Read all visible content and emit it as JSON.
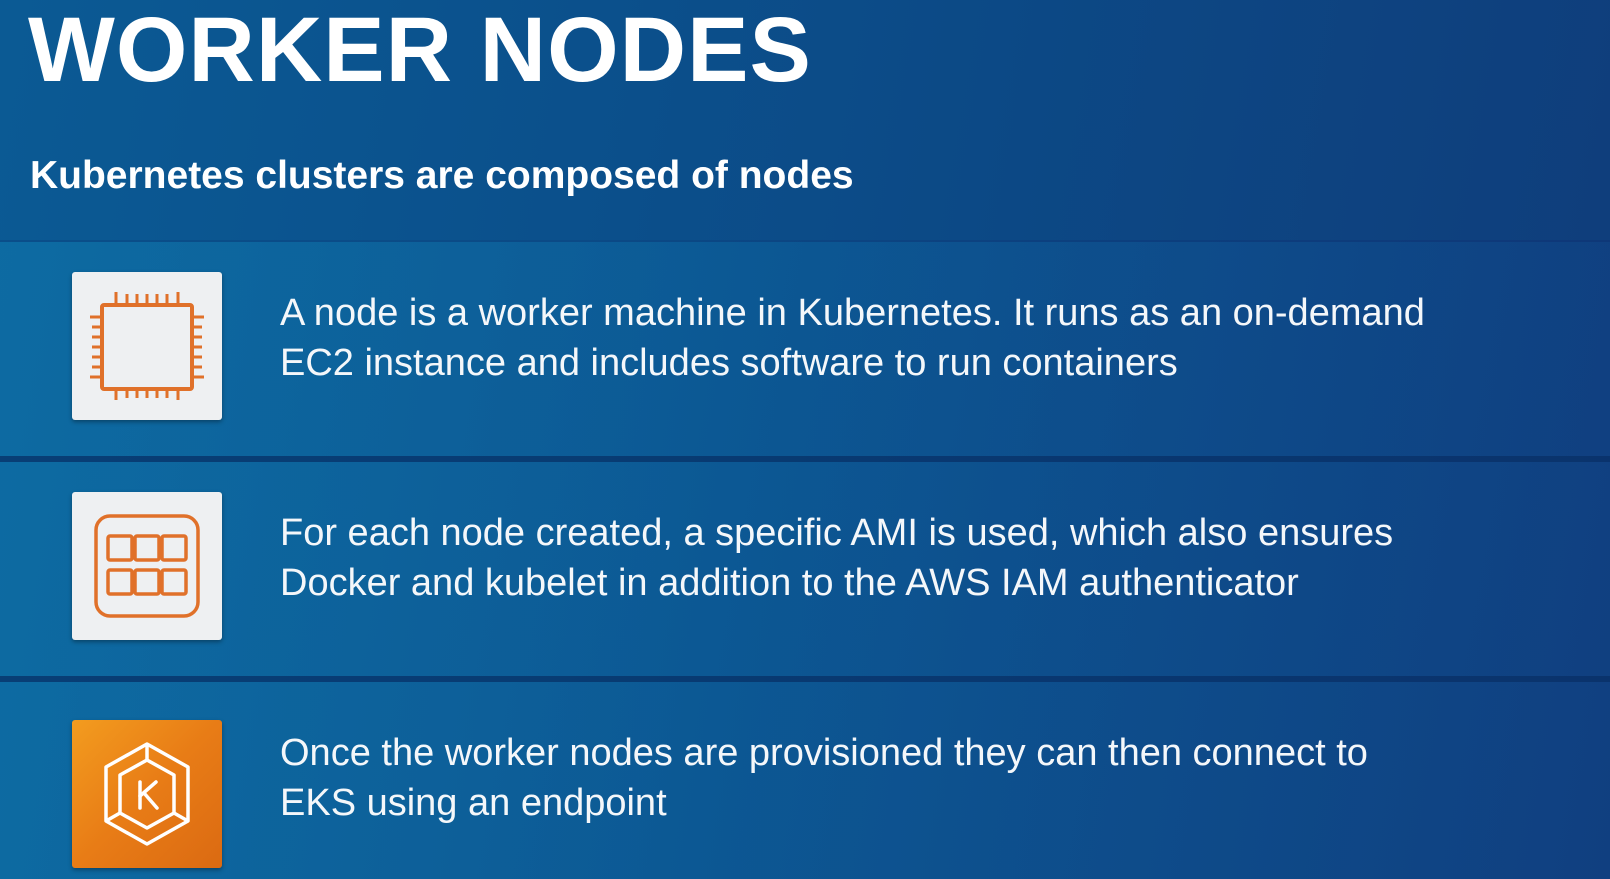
{
  "title": "WORKER NODES",
  "subtitle": "Kubernetes clusters are composed of nodes",
  "rows": [
    {
      "icon": "processor-chip-icon",
      "line1": "A node is a worker machine in Kubernetes. It runs as an on-demand",
      "line2": "EC2 instance and includes software to run containers"
    },
    {
      "icon": "ami-grid-icon",
      "line1": "For each node created, a specific AMI is used, which also ensures",
      "line2": "Docker and kubelet in addition to the AWS IAM authenticator"
    },
    {
      "icon": "eks-kubernetes-icon",
      "line1": "Once the worker nodes are provisioned they can then connect to",
      "line2": "EKS using an endpoint"
    }
  ],
  "colors": {
    "accent_orange": "#e8801a",
    "icon_stroke": "#e0712a",
    "tile_light": "#eef0f2"
  }
}
